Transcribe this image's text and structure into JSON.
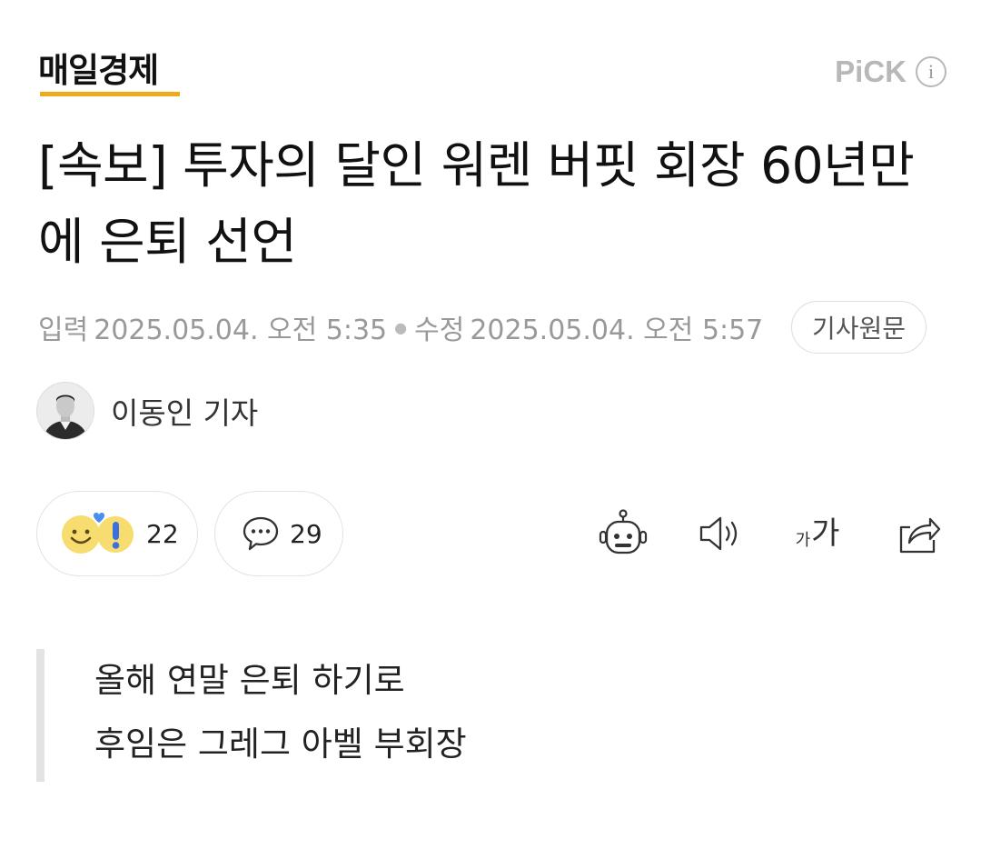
{
  "header": {
    "brand": "매일경제",
    "pick_label": "PiCK",
    "info_glyph": "i"
  },
  "article": {
    "title": "[속보] 투자의 달인 워렌 버핏 회장 60년만에 은퇴 선언",
    "published_label": "입력",
    "published_at": "2025.05.04. 오전 5:35",
    "modified_label": "수정",
    "modified_at": "2025.05.04. 오전 5:57",
    "original_button": "기사원문",
    "reporter": "이동인 기자",
    "summary": [
      "올해 연말 은퇴 하기로",
      "후임은 그레그 아벨 부회장"
    ]
  },
  "actions": {
    "reaction_count": "22",
    "comment_count": "29",
    "font_size_label_small": "가",
    "font_size_label_large": "가"
  },
  "colors": {
    "brand_underline": "#f0a81c",
    "muted_text": "#999999",
    "quote_bar": "#e3e3e3"
  },
  "icons": [
    "smile-emoji-icon",
    "exclamation-emoji-icon",
    "heart-icon",
    "comment-bubble-icon",
    "summary-bot-icon",
    "speaker-icon",
    "font-size-icon",
    "share-icon"
  ]
}
